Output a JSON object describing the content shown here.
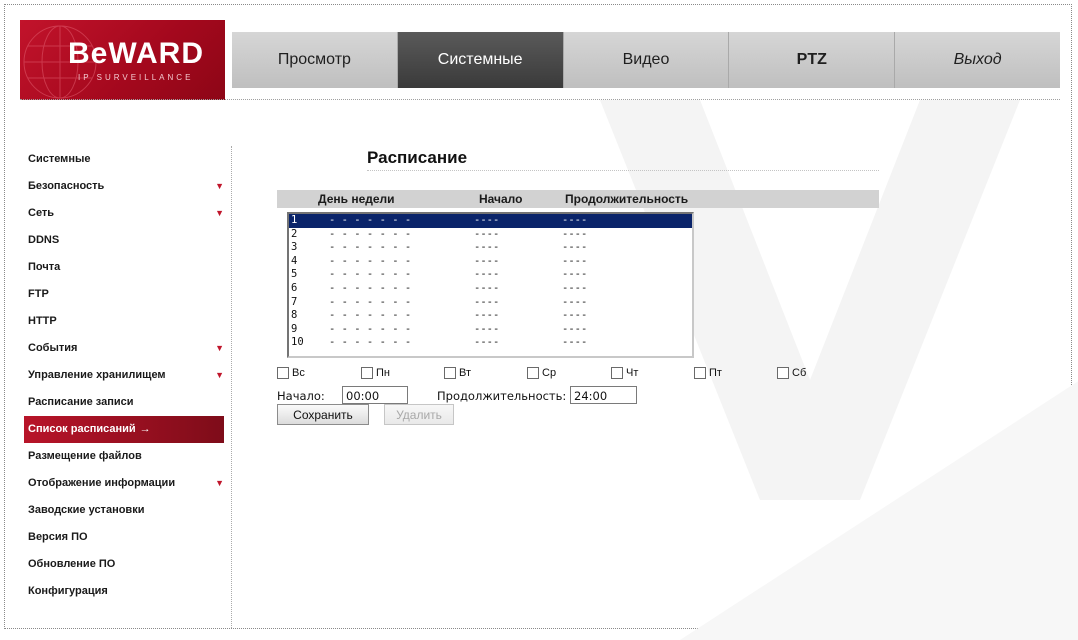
{
  "brand": {
    "name": "BeWARD",
    "tagline": "IP SURVEILLANCE"
  },
  "nav": [
    {
      "label": "Просмотр"
    },
    {
      "label": "Системные"
    },
    {
      "label": "Видео"
    },
    {
      "label": "PTZ"
    },
    {
      "label": "Выход"
    }
  ],
  "sidebar": {
    "items": [
      {
        "label": "Системные"
      },
      {
        "label": "Безопасность",
        "has_submenu": true
      },
      {
        "label": "Сеть",
        "has_submenu": true
      },
      {
        "label": "DDNS"
      },
      {
        "label": "Почта"
      },
      {
        "label": "FTP"
      },
      {
        "label": "HTTP"
      },
      {
        "label": "События",
        "has_submenu": true
      },
      {
        "label": "Управление хранилищем",
        "has_submenu": true
      },
      {
        "label": "Расписание записи"
      },
      {
        "label": "Список расписаний",
        "active": true
      },
      {
        "label": "Размещение файлов"
      },
      {
        "label": "Отображение информации",
        "has_submenu": true
      },
      {
        "label": "Заводские установки"
      },
      {
        "label": "Версия ПО"
      },
      {
        "label": "Обновление ПО"
      },
      {
        "label": "Конфигурация"
      }
    ],
    "submenu_arrow": "▼",
    "active_arrow": "→"
  },
  "page": {
    "title": "Расписание"
  },
  "table": {
    "headers": {
      "day": "День недели",
      "start": "Начало",
      "duration": "Продолжительность"
    },
    "rows": [
      {
        "num": "1",
        "days": "- - - - - - -",
        "start": "----",
        "duration": "----",
        "selected": true
      },
      {
        "num": "2",
        "days": "- - - - - - -",
        "start": "----",
        "duration": "----"
      },
      {
        "num": "3",
        "days": "- - - - - - -",
        "start": "----",
        "duration": "----"
      },
      {
        "num": "4",
        "days": "- - - - - - -",
        "start": "----",
        "duration": "----"
      },
      {
        "num": "5",
        "days": "- - - - - - -",
        "start": "----",
        "duration": "----"
      },
      {
        "num": "6",
        "days": "- - - - - - -",
        "start": "----",
        "duration": "----"
      },
      {
        "num": "7",
        "days": "- - - - - - -",
        "start": "----",
        "duration": "----"
      },
      {
        "num": "8",
        "days": "- - - - - - -",
        "start": "----",
        "duration": "----"
      },
      {
        "num": "9",
        "days": "- - - - - - -",
        "start": "----",
        "duration": "----"
      },
      {
        "num": "10",
        "days": "- - - - - - -",
        "start": "----",
        "duration": "----"
      }
    ]
  },
  "weekdays": [
    {
      "label": "Вс",
      "checked": false
    },
    {
      "label": "Пн",
      "checked": false
    },
    {
      "label": "Вт",
      "checked": false
    },
    {
      "label": "Ср",
      "checked": false
    },
    {
      "label": "Чт",
      "checked": false
    },
    {
      "label": "Пт",
      "checked": false
    },
    {
      "label": "Сб",
      "checked": false
    }
  ],
  "form": {
    "start_label": "Начало:",
    "start_value": "00:00",
    "duration_label": "Продолжительность:",
    "duration_value": "24:00"
  },
  "buttons": {
    "save": "Сохранить",
    "delete": "Удалить"
  },
  "colors": {
    "accent": "#b81429",
    "selection": "#0a246a",
    "nav_active": "#4a4a4a"
  }
}
